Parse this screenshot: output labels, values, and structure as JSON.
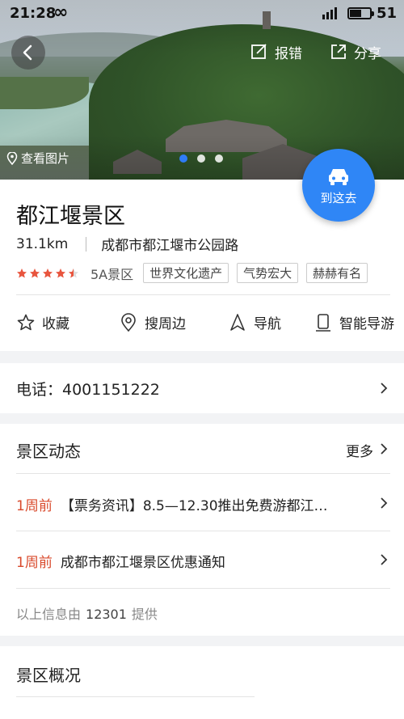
{
  "status_bar": {
    "time": "21:28",
    "infinity": "∞",
    "battery": "51"
  },
  "hero": {
    "report_label": "报错",
    "share_label": "分享",
    "view_photos_label": "查看图片",
    "carousel_count": 3,
    "carousel_active": 0
  },
  "navigate_fab": {
    "label": "到这去"
  },
  "place": {
    "name": "都江堰景区",
    "distance": "31.1km",
    "address": "成都市都江堰市公园路",
    "rating_stars": 4.5,
    "level": "5A景区",
    "tags": [
      "世界文化遗产",
      "气势宏大",
      "赫赫有名"
    ]
  },
  "actions": {
    "favorite": "收藏",
    "nearby": "搜周边",
    "navigate": "导航",
    "audio_guide": "智能导游"
  },
  "phone": {
    "label": "电话：4001151222"
  },
  "news": {
    "title": "景区动态",
    "more": "更多",
    "items": [
      {
        "when": "1周前",
        "text": "【票务资讯】8.5—12.30推出免费游都江…"
      },
      {
        "when": "1周前",
        "text": "成都市都江堰景区优惠通知"
      }
    ],
    "source_prefix": "以上信息由",
    "source_name": "12301",
    "source_suffix": "提供"
  },
  "overview": {
    "title": "景区概况"
  },
  "colors": {
    "accent": "#2f86f6",
    "time_red": "#d94a2c",
    "star": "#e8553e"
  }
}
